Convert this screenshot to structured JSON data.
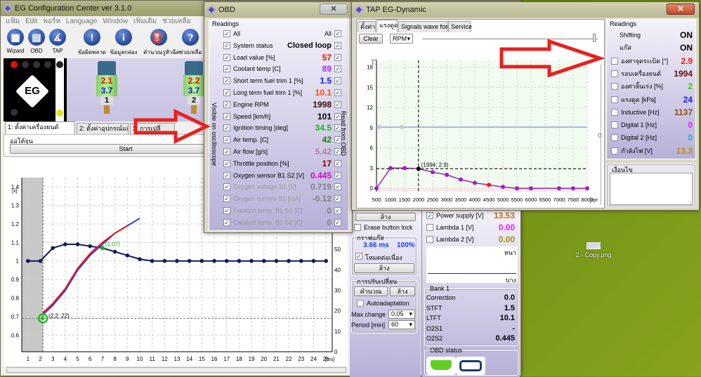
{
  "colors": {
    "accent": "#e02020",
    "lavender": "#b6b0d8",
    "desktop": "#7f9a1a"
  },
  "main": {
    "title": "EG Configuration Center ver 3.1.0",
    "menu": [
      "แฟ้ม",
      "Edit",
      "พอร์ท",
      "Language",
      "Window",
      "เพิ่มเติม",
      "ช่วยเหลือ"
    ],
    "toolbar": [
      {
        "label": "Wizard",
        "icon": "wizard-icon"
      },
      {
        "label": "OBD",
        "icon": "obd-connector-icon"
      },
      {
        "label": "TAP",
        "icon": "tap-gauge-icon"
      },
      {
        "label": "ข้อผิดพลาด",
        "icon": "exclamation-icon"
      },
      {
        "label": "ข้อมูลกล่อง",
        "icon": "info-icon"
      },
      {
        "label": "คำนวณรูหัวฉีด",
        "icon": "injector-icon"
      },
      {
        "label": "ช่วยเหลือ",
        "icon": "help-icon"
      }
    ],
    "logo": "EG",
    "injectors": [
      {
        "num": "1",
        "top": "2.1",
        "bottom": "3.7"
      },
      {
        "num": "2",
        "top": "2.2",
        "bottom": "3.7"
      }
    ],
    "tabs": [
      "1: ตั้งค่าเครื่องยนต์",
      "2: ตั้งค่าอุปกรณ์แก๊ส",
      "3: การเปลี่"
    ],
    "autotune_label": "ออโต้จูน",
    "start_label": "Start"
  },
  "chart_data": [
    {
      "type": "line",
      "ylabel_left": "[x]",
      "xlabel": "[ms]",
      "xlim": [
        0.5,
        25.5
      ],
      "ylim": [
        0.51,
        1.45
      ],
      "ylim_right": [
        0,
        85
      ],
      "x_ticks": [
        1,
        2,
        3,
        4,
        5,
        6,
        7,
        8,
        9,
        10,
        11,
        12,
        13,
        14,
        15,
        16,
        17,
        18,
        19,
        20,
        21,
        22,
        23,
        24,
        25
      ],
      "y_ticks": [
        0.6,
        0.7,
        0.8,
        0.9,
        1.0,
        1.1,
        1.2,
        1.3,
        1.4
      ],
      "y_ticks_right": [
        0,
        10,
        20,
        30,
        40,
        50,
        60,
        70,
        80
      ],
      "grid": true,
      "series": [
        {
          "color": "#141a5c",
          "markers": true,
          "x": [
            1,
            2,
            3,
            4,
            5,
            6,
            7,
            8,
            9,
            10,
            11,
            12,
            13,
            14,
            15,
            16,
            17,
            18,
            19,
            20,
            21,
            22,
            23,
            24,
            25
          ],
          "y": [
            1.0,
            1.0,
            1.07,
            1.09,
            1.09,
            1.08,
            1.07,
            1.05,
            1.03,
            1.01,
            1.0,
            1.0,
            1.0,
            1.0,
            1.0,
            1.0,
            1.0,
            1.0,
            1.0,
            1.0,
            1.0,
            1.0,
            1.0,
            1.0,
            1.0
          ]
        },
        {
          "color": "#3040f0",
          "markers": false,
          "x": [
            2.2,
            3,
            4,
            5,
            6,
            7,
            8,
            9,
            10
          ],
          "y": [
            0.71,
            0.76,
            0.84,
            0.95,
            1.03,
            1.09,
            1.15,
            1.19,
            1.23
          ]
        },
        {
          "color": "#f01010",
          "markers": false,
          "x": [
            2.2,
            3,
            4,
            5,
            6,
            7,
            8,
            9
          ],
          "y": [
            0.72,
            0.77,
            0.85,
            0.96,
            1.04,
            1.1,
            1.15,
            1.19
          ]
        }
      ],
      "shaded_until_x": 2.2,
      "marker": {
        "x": 2.2,
        "y": 0.69,
        "label": "(2,2; 22)"
      },
      "point_label": {
        "x": 7,
        "y": 1.07,
        "label": "(1.07)"
      }
    },
    {
      "type": "line",
      "ylabel": "[°]",
      "xlabel": "[rpm]",
      "xlim": [
        500,
        8000
      ],
      "ylim": [
        -0.5,
        19
      ],
      "x_ticks": [
        500,
        1000,
        1500,
        2000,
        2500,
        3000,
        3500,
        4000,
        4500,
        5000,
        5500,
        6000,
        6500,
        7000,
        7500,
        8000
      ],
      "y_ticks": [
        0,
        3,
        6,
        9,
        12,
        15,
        18
      ],
      "grid": true,
      "series": [
        {
          "color": "#a020c0",
          "x": [
            500,
            1000,
            1500,
            2000,
            2500,
            3000,
            3500,
            4000,
            4500,
            5000,
            5500,
            6000,
            7000,
            7500,
            8000
          ],
          "y": [
            0,
            3,
            3,
            2.9,
            2.4,
            2,
            1.3,
            0.8,
            0.5,
            0.2,
            0,
            0,
            0,
            0,
            0
          ],
          "highlight_x": 4500
        },
        {
          "color": "#9aa6d8",
          "x": [
            600,
            1400
          ],
          "y": [
            9.1,
            9.1
          ],
          "line_level": 9.1
        }
      ],
      "crosshair": {
        "x": 1994,
        "y": 2.9,
        "label": "(1994; 2.9)"
      }
    }
  ],
  "obd": {
    "title": "OBD",
    "readings_label": "Readings",
    "all_left": "All",
    "all_right": "All",
    "side_left": "Visible on oscilloscope",
    "side_right": "Read from OBD",
    "rows": [
      {
        "label": "System status",
        "value": "Closed loop",
        "color": "#000000",
        "enabled": true
      },
      {
        "label": "Load value [%]",
        "value": "57",
        "color": "#ff0000",
        "enabled": true
      },
      {
        "label": "Coolant temp [C]",
        "value": "89",
        "color": "#9b30ff",
        "enabled": true
      },
      {
        "label": "Short term fuel trim 1 [%]",
        "value": "1.5",
        "color": "#1020ff",
        "enabled": true
      },
      {
        "label": "Long term fuel trim 1 [%]",
        "value": "10.1",
        "color": "#ff4a00",
        "enabled": true
      },
      {
        "label": "Engine RPM",
        "value": "1998",
        "color": "#3a0a0a",
        "enabled": true
      },
      {
        "label": "Speed [km/h]",
        "value": "101",
        "color": "#000000",
        "enabled": true
      },
      {
        "label": "Ignition timing [deg]",
        "value": "34.5",
        "color": "#20b020",
        "enabled": true
      },
      {
        "label": "Air temp. [C]",
        "value": "42",
        "color": "#108010",
        "enabled": true
      },
      {
        "label": "Air flow [g/s]",
        "value": "5.42",
        "color": "#b080a8",
        "enabled": true
      },
      {
        "label": "Throttle position [%]",
        "value": "17",
        "color": "#900010",
        "enabled": true
      },
      {
        "label": "Oxygen sensor B1 S2 [V]",
        "value": "0.445",
        "color": "#d000d0",
        "enabled": true
      },
      {
        "label": "Oxygen voltage S1 [V]",
        "value": "0.719",
        "color": "#808080",
        "enabled": false
      },
      {
        "label": "Oxygen current S1 [mA]",
        "value": "-0.12",
        "color": "#808080",
        "enabled": false
      },
      {
        "label": "Catalyst temp. B1 S1 [C]",
        "value": "0",
        "color": "#808080",
        "enabled": false
      },
      {
        "label": "Catalyst temp. B1 S2 [C]",
        "value": "0",
        "color": "#808080",
        "enabled": false
      }
    ]
  },
  "tap": {
    "title": "TAP EG-Dynamic",
    "tabs": [
      "ตั้งค่า",
      "แรงดูด",
      "Signals wave form",
      "Service"
    ],
    "clear_label": "Clear",
    "axis_select": "RPM",
    "slider_value": "0",
    "readings_label": "Readings",
    "status": [
      {
        "label": "Shifting",
        "value": "ON"
      },
      {
        "label": "แก๊ส",
        "value": "ON"
      }
    ],
    "readings": [
      {
        "label": "องศาจุดระเบิด [°]",
        "value": "2.9",
        "color": "#ff1010"
      },
      {
        "label": "รอบเครื่องยนต์",
        "value": "1994",
        "color": "#6a1010"
      },
      {
        "label": "องศาลิ้นเร่ง [%]",
        "value": "2",
        "color": "#30d000"
      },
      {
        "label": "แรงดูด [kPa]",
        "value": "24",
        "color": "#1020ff"
      },
      {
        "label": "Inductive [Hz]",
        "value": "1137",
        "color": "#8b4a13"
      },
      {
        "label": "Digital 1 [Hz]",
        "value": "0",
        "color": "#ff10ff"
      },
      {
        "label": "Digital 2 [Hz]",
        "value": "0",
        "color": "#10b8c8"
      },
      {
        "label": "กำลังไฟ [V]",
        "value": "13.3",
        "color": "#b8901a"
      }
    ],
    "condition_label": "เงื่อนไข"
  },
  "lower": {
    "clear_top": "ล้าง",
    "erase_lock": "Erase button lock",
    "gas_graph_label": "กราฟแก๊ส",
    "ms": "3.66 ms",
    "pct": "100%",
    "continuous": "โหมดต่อเนื่อง",
    "clear2": "ล้าง",
    "adapt_label": "การปรับเปลี่ยน",
    "calc": "คำนวณ",
    "clear3": "ล้าง",
    "autoadapt": "Autoadaptation",
    "max_change_label": "Max change",
    "max_change": "0,05",
    "period_label": "Period [min]",
    "period": "60",
    "supply": [
      {
        "label": "Power supply [V]",
        "value": "13.53",
        "color": "#c07010",
        "checked": true
      },
      {
        "label": "Lambda 1 [V]",
        "value": "0.00",
        "color": "#ff10ff",
        "checked": false
      },
      {
        "label": "Lambda 2 [V]",
        "value": "0.00",
        "color": "#a09000",
        "checked": false
      }
    ],
    "rich": "หนา",
    "lean": "บาง",
    "bank_label": "Bank 1",
    "bank": [
      {
        "label": "Correction",
        "value": "0.0"
      },
      {
        "label": "STFT",
        "value": "1.5"
      },
      {
        "label": "LTFT",
        "value": "10.1"
      },
      {
        "label": "O2S1",
        "value": "-"
      },
      {
        "label": "O2S2",
        "value": "0.445"
      }
    ],
    "obd_status_label": "OBD status"
  },
  "desktop": {
    "icon_label": "2 - Copy.png"
  }
}
